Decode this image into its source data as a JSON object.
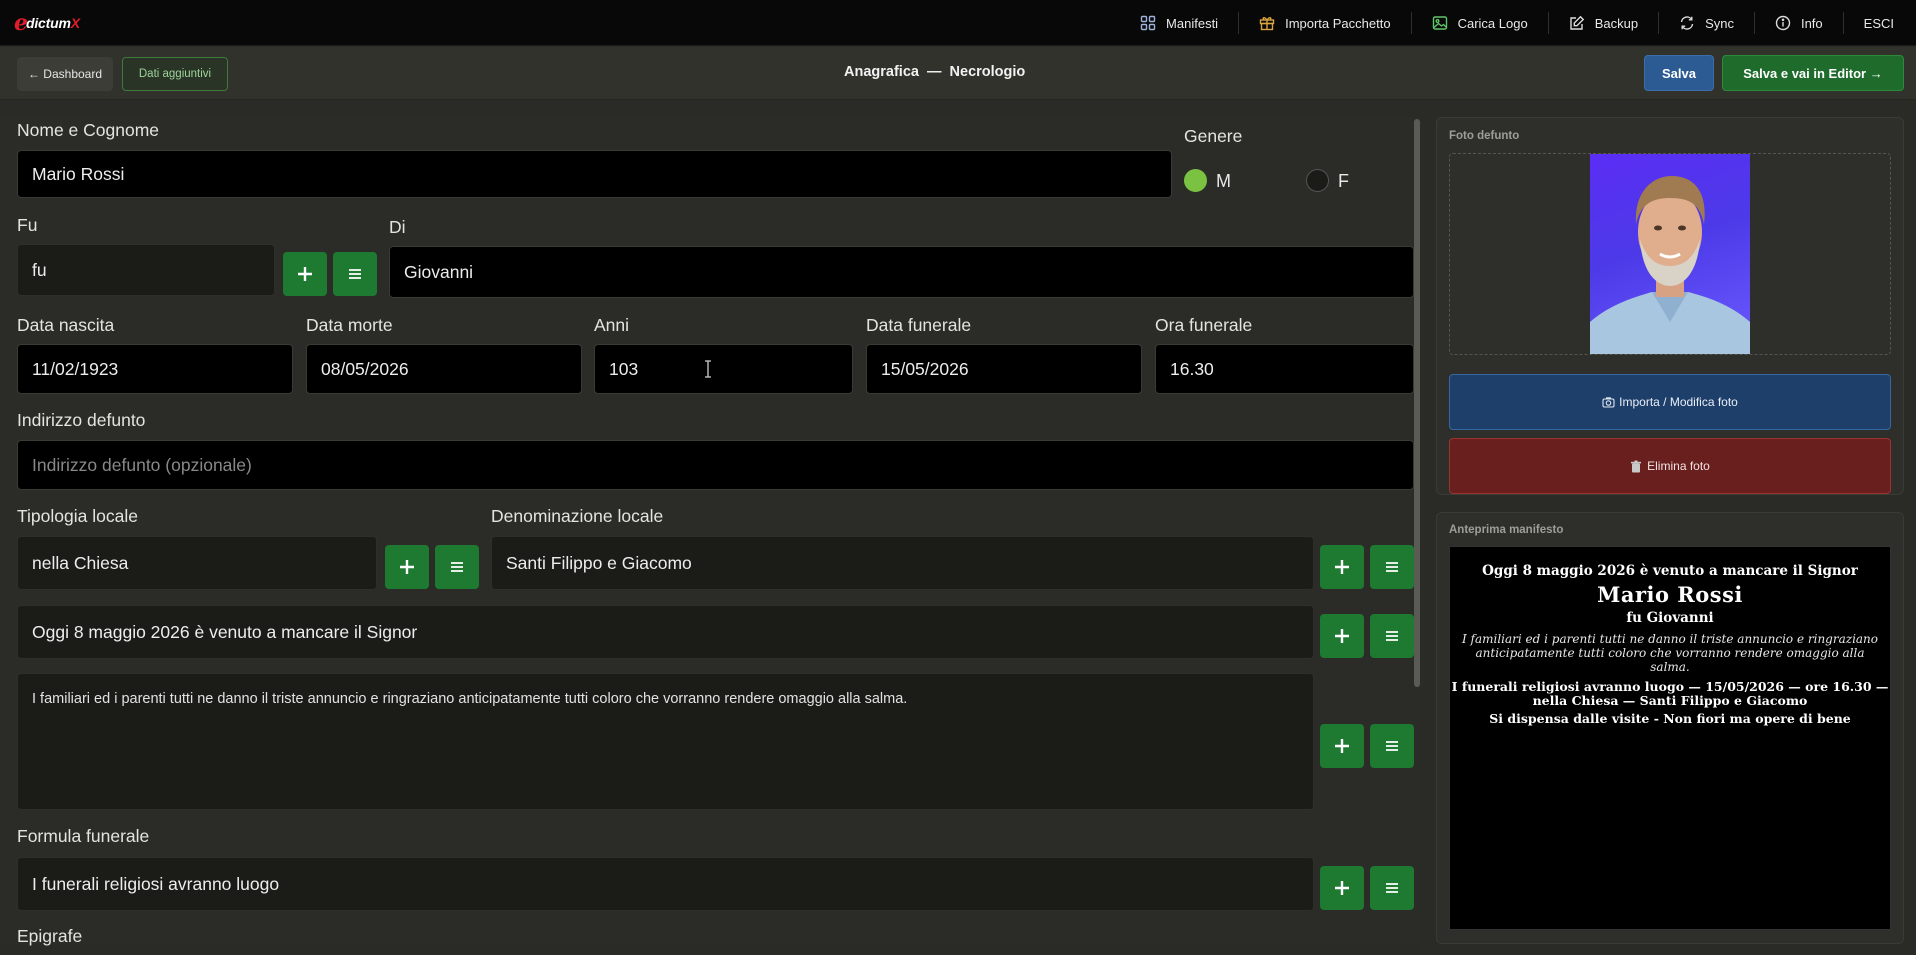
{
  "app": {
    "logo_text": "dictumX"
  },
  "topnav": [
    {
      "label": "Manifesti",
      "icon": "grid-icon"
    },
    {
      "label": "Importa Pacchetto",
      "icon": "gift-icon"
    },
    {
      "label": "Carica Logo",
      "icon": "image-icon"
    },
    {
      "label": "Backup",
      "icon": "edit-icon"
    },
    {
      "label": "Sync",
      "icon": "sync-icon"
    },
    {
      "label": "Info",
      "icon": "info-icon"
    },
    {
      "label": "ESCI",
      "icon": ""
    }
  ],
  "subbar": {
    "dashboard_label": "← Dashboard",
    "dati_label": "Dati aggiuntivi",
    "title": "Anagrafica  —  Necrologio",
    "salva_label": "Salva",
    "salva_editor_label": "Salva e vai in Editor →"
  },
  "form": {
    "nome_label": "Nome e Cognome",
    "nome_value": "Mario Rossi",
    "genere_label": "Genere",
    "genere_m": "M",
    "genere_f": "F",
    "genere_selected": "M",
    "fu_label": "Fu",
    "fu_value": "fu",
    "di_label": "Di",
    "di_value": "Giovanni",
    "data_nascita_label": "Data nascita",
    "data_nascita_value": "11/02/1923",
    "data_morte_label": "Data morte",
    "data_morte_value": "08/05/2026",
    "anni_label": "Anni",
    "anni_value": "103",
    "data_funerale_label": "Data funerale",
    "data_funerale_value": "15/05/2026",
    "ora_funerale_label": "Ora funerale",
    "ora_funerale_value": "16.30",
    "indirizzo_label": "Indirizzo defunto",
    "indirizzo_placeholder": "Indirizzo defunto (opzionale)",
    "tipologia_label": "Tipologia locale",
    "tipologia_value": "nella Chiesa",
    "denominazione_label": "Denominazione locale",
    "denominazione_value": "Santi Filippo e Giacomo",
    "annuncio_value": "Oggi 8 maggio 2026 è venuto a mancare il Signor",
    "familiari_value": "I familiari ed i parenti tutti ne danno il triste annuncio e ringraziano anticipatamente tutti coloro che vorranno rendere omaggio alla salma.",
    "formula_label": "Formula funerale",
    "formula_value": "I funerali religiosi avranno luogo",
    "epigrafe_label": "Epigrafe"
  },
  "side": {
    "foto_title": "Foto defunto",
    "importa_label": "Importa / Modifica foto",
    "elimina_label": "Elimina foto",
    "anteprima_title": "Anteprima manifesto"
  },
  "preview": {
    "line1": "Oggi 8 maggio 2026 è venuto a mancare il Signor",
    "name": "Mario Rossi",
    "fu": "fu Giovanni",
    "familiari": "I familiari ed i parenti tutti ne danno il triste annuncio e ringraziano anticipatamente tutti coloro che vorranno rendere omaggio alla salma.",
    "funerali": "I funerali religiosi avranno luogo — 15/05/2026 — ore 16.30 — nella Chiesa — Santi Filippo e Giacomo",
    "dispensa": "Si dispensa dalle visite - Non fiori ma opere di bene"
  },
  "colors": {
    "accent_green": "#1e7a30",
    "accent_blue": "#2c5b93",
    "danger": "#6a1f1f",
    "logo_red": "#e11d2a"
  }
}
